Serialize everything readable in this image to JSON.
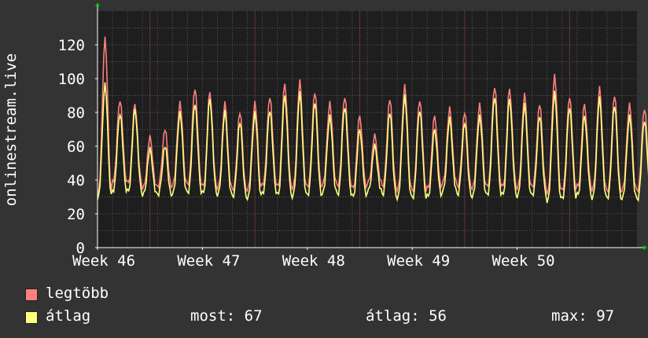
{
  "chart_data": {
    "type": "line",
    "ylabel": "onlinestream.live",
    "ylim": [
      0,
      140
    ],
    "yticks": [
      0,
      20,
      40,
      60,
      80,
      100,
      120
    ],
    "xlim": [
      0,
      36
    ],
    "xticks": [
      {
        "label": "Week 46",
        "day": 0
      },
      {
        "label": "Week 47",
        "day": 7
      },
      {
        "label": "Week 48",
        "day": 14
      },
      {
        "label": "Week 49",
        "day": 21
      },
      {
        "label": "Week 50",
        "day": 28
      }
    ],
    "grid": true,
    "series": [
      {
        "name": "legtöbb",
        "color": "#ff7f7f",
        "daily_peak": [
          124,
          88,
          85,
          65,
          70,
          86,
          95,
          92,
          85,
          80,
          86,
          90,
          97,
          98,
          92,
          86,
          90,
          78,
          66,
          88,
          96,
          88,
          78,
          82,
          80,
          85,
          96,
          94,
          90,
          85,
          102,
          90,
          85,
          94,
          90,
          85,
          83
        ],
        "daily_low": [
          32,
          40,
          38,
          35,
          36,
          38,
          38,
          36,
          35,
          34,
          35,
          38,
          36,
          35,
          36,
          38,
          37,
          35,
          38,
          36,
          35,
          34,
          35,
          38,
          36,
          36,
          37,
          36,
          35,
          36,
          33,
          35,
          36,
          34,
          33,
          35,
          34
        ]
      },
      {
        "name": "átlag",
        "color": "#ffff7f",
        "daily_peak": [
          97,
          80,
          82,
          58,
          60,
          80,
          86,
          88,
          80,
          74,
          80,
          82,
          90,
          91,
          86,
          78,
          84,
          70,
          60,
          80,
          90,
          82,
          70,
          76,
          74,
          78,
          90,
          88,
          84,
          78,
          92,
          84,
          78,
          88,
          84,
          78,
          76
        ],
        "daily_low": [
          30,
          34,
          33,
          31,
          31,
          33,
          33,
          32,
          31,
          30,
          30,
          33,
          31,
          30,
          31,
          33,
          32,
          30,
          33,
          31,
          30,
          30,
          30,
          33,
          31,
          31,
          32,
          31,
          30,
          31,
          28,
          30,
          31,
          29,
          29,
          30,
          29
        ]
      }
    ]
  },
  "legend": [
    {
      "label": "legtöbb",
      "color": "#ff7f7f"
    },
    {
      "label": "átlag",
      "color": "#ffff7f"
    }
  ],
  "stats": {
    "now": "most: 67",
    "avg": "átlag: 56",
    "max": "max: 97"
  },
  "colors": {
    "background": "#333333",
    "plot_bg": "#1e1e1e",
    "grid": "#5a5a5a",
    "major_grid": "#a05050",
    "axis": "#ffffff"
  }
}
